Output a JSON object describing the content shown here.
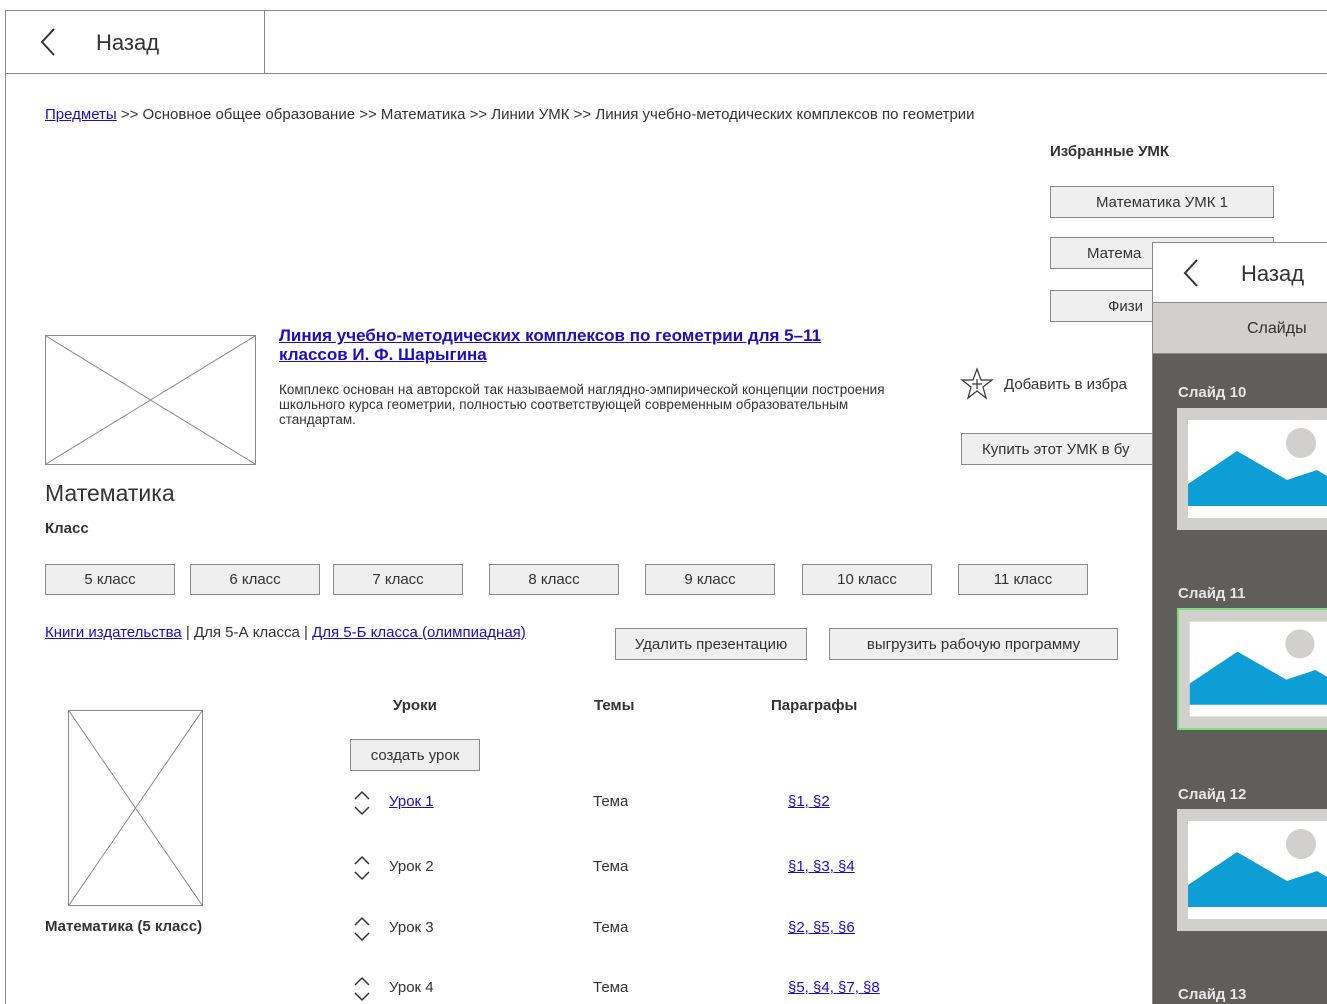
{
  "header": {
    "back_label": "Назад"
  },
  "breadcrumb": {
    "root_link": "Предметы",
    "rest": " >> Основное общее образование >> Математика >> Линии УМК >> Линия учебно-методических комплексов по геометрии"
  },
  "favorites": {
    "title": "Избранные УМК",
    "items": [
      "Математика УМК 1",
      "Матема",
      "Физи"
    ]
  },
  "kit": {
    "title": "Линия учебно-методических комплексов по геометрии для 5–11 классов И. Ф. Шарыгина",
    "description": "Комплекс основан на авторской так называемой наглядно-эмпирической концепции построения школьного курса геометрии, полностью соответствующей современным образовательным стандартам.",
    "add_favorite": "Добавить в избра",
    "buy_button": "Купить этот УМК в бу"
  },
  "subject": {
    "title": "Математика",
    "class_label": "Класс",
    "classes": [
      "5 класс",
      "6 класс",
      "7 класс",
      "8 класс",
      "9 класс",
      "10 класс",
      "11 класс"
    ]
  },
  "filters": {
    "books_link": "Книги издательства",
    "sep1": " | ",
    "current": "Для 5-А класса",
    "sep2": " | ",
    "olymp_link": "Для 5-Б класса (олимпиадная)",
    "delete_button": "Удалить презентацию",
    "export_button": "выгрузить рабочую программу"
  },
  "lessons": {
    "col_lessons": "Уроки",
    "col_topics": "Темы",
    "col_paragraphs": "Параграфы",
    "create_button": "создать урок",
    "rows": [
      {
        "lesson": "Урок 1",
        "topic": "Тема",
        "paragraphs": "§1, §2"
      },
      {
        "lesson": "Урок 2",
        "topic": "Тема",
        "paragraphs": "§1, §3, §4"
      },
      {
        "lesson": "Урок 3",
        "topic": "Тема",
        "paragraphs": "§2, §5, §6"
      },
      {
        "lesson": "Урок 4",
        "topic": "Тема",
        "paragraphs": "§5, §4, §7, §8"
      }
    ]
  },
  "book_caption": "Математика (5 класс)",
  "slides_panel": {
    "back_label": "Назад",
    "tab_label": "Слайды",
    "slides": [
      "Слайд 10",
      "Слайд 11",
      "Слайд 12",
      "Слайд 13"
    ],
    "active_slide": "Слайд 11"
  },
  "colors": {
    "link": "#1a0dcc",
    "panel_bg": "#5f5e5b",
    "thumb_bg": "#d1d0cd",
    "thumb_mountain": "#0e9ed6",
    "active_border": "#7ddc7d"
  }
}
